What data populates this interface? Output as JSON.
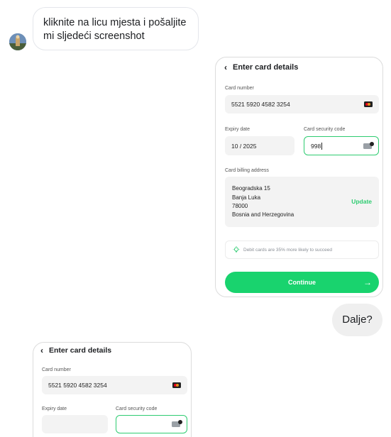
{
  "chat": {
    "incoming_message": "kliknite na licu mjesta i pošaljite mi sljedeći screenshot",
    "outgoing_message": "Dalje?"
  },
  "card_form": {
    "title": "Enter card details",
    "card_number_label": "Card number",
    "card_number": "5521 5920 4582 3254",
    "expiry_label": "Expiry date",
    "expiry_value": "10 / 2025",
    "security_code_label": "Card security code",
    "security_code_value": "998",
    "billing_label": "Card billing address",
    "billing_address": [
      "Beogradska 15",
      "Banja Luka",
      "78000",
      "Bosnia and Herzegovina"
    ],
    "update_label": "Update",
    "tip_text": "Debit cards are 35% more likely to succeed",
    "continue_label": "Continue",
    "accent_color": "#19d36e"
  },
  "card_form_repeat": {
    "title": "Enter card details",
    "card_number_label": "Card number",
    "card_number": "5521 5920 4582 3254",
    "expiry_label": "Expiry date",
    "security_code_label": "Card security code"
  }
}
